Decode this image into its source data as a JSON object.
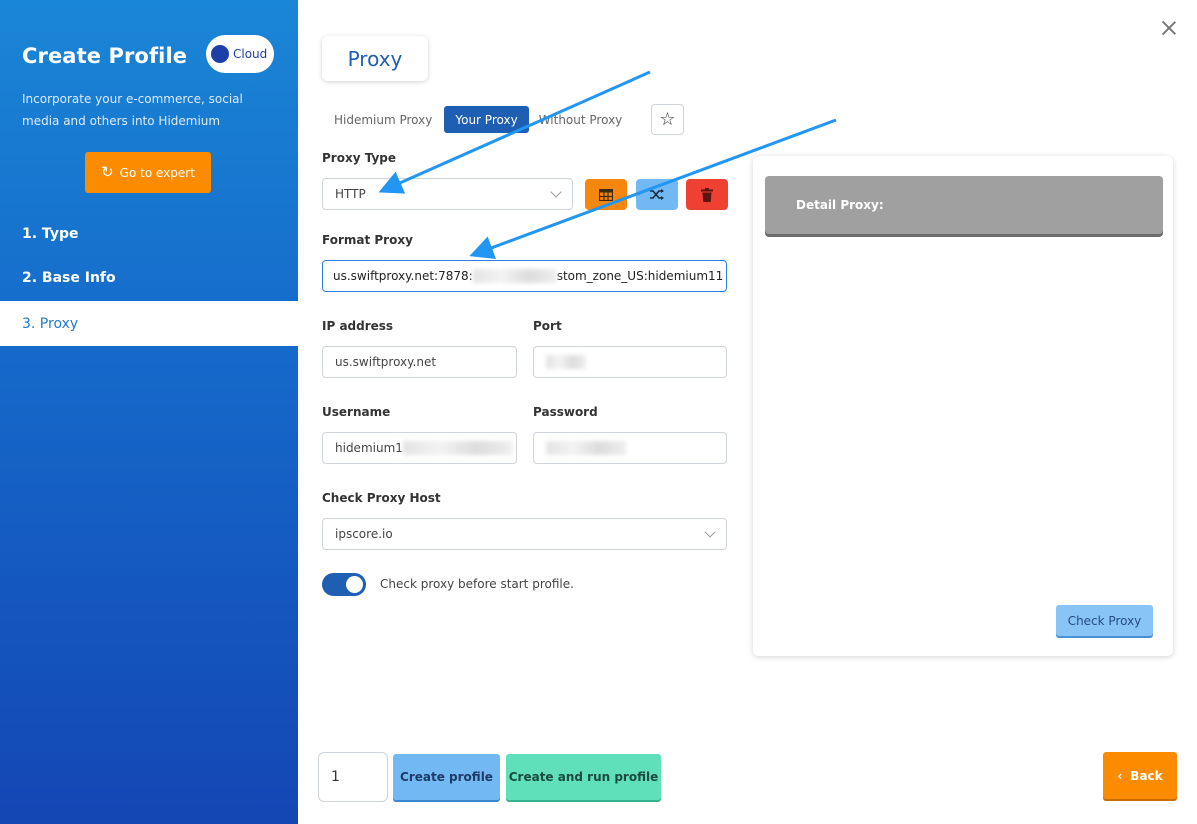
{
  "sidebar": {
    "title": "Create Profile",
    "cloud_label": "Cloud",
    "description": "Incorporate your e-commerce, social media and others into Hidemium",
    "expert_button": "Go to expert",
    "nav": [
      {
        "label": "1. Type",
        "active": false
      },
      {
        "label": "2. Base Info",
        "active": false
      },
      {
        "label": "3. Proxy",
        "active": true
      }
    ]
  },
  "main": {
    "section_title": "Proxy",
    "tabs": [
      {
        "label": "Hidemium Proxy",
        "active": false
      },
      {
        "label": "Your Proxy",
        "active": true
      },
      {
        "label": "Without Proxy",
        "active": false
      }
    ],
    "proxy_type": {
      "label": "Proxy Type",
      "value": "HTTP"
    },
    "format_proxy": {
      "label": "Format Proxy",
      "value_start": "us.swiftproxy.net:7878:",
      "value_end": "stom_zone_US:hidemium11"
    },
    "ip_address": {
      "label": "IP address",
      "value": "us.swiftproxy.net"
    },
    "port": {
      "label": "Port"
    },
    "username": {
      "label": "Username",
      "value": "hidemium1"
    },
    "password": {
      "label": "Password"
    },
    "check_host": {
      "label": "Check Proxy Host",
      "value": "ipscore.io"
    },
    "check_before_start": {
      "label": "Check proxy before start profile.",
      "enabled": true
    }
  },
  "detail": {
    "header": "Detail Proxy:",
    "check_button": "Check Proxy"
  },
  "footer": {
    "quantity": "1",
    "create_profile": "Create profile",
    "create_and_run": "Create and run profile",
    "back": "Back"
  },
  "colors": {
    "sidebar_top": "#1a86d6",
    "sidebar_bottom": "#1446b4",
    "accent_orange": "#fb8c00",
    "accent_blue": "#1f5fb3",
    "danger_red": "#ef4133",
    "annotation_arrow": "#2196f3"
  }
}
